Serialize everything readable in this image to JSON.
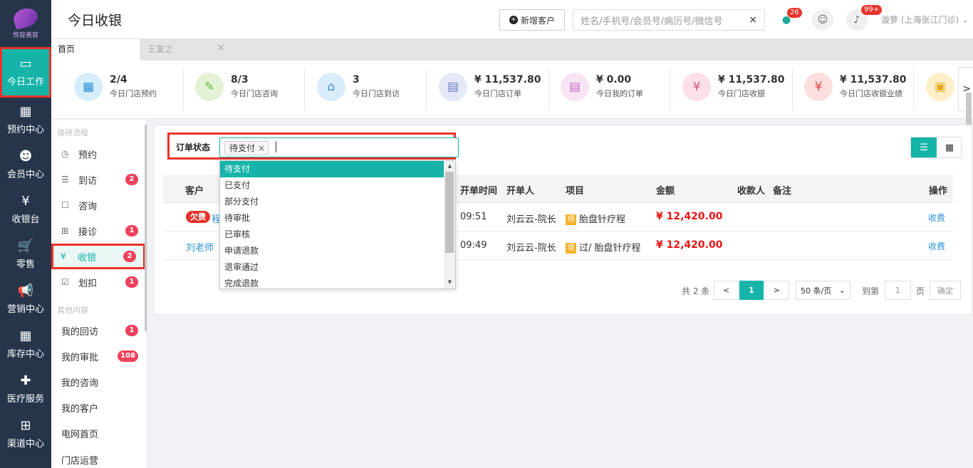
{
  "brand": {
    "logo_text": "悦容美容"
  },
  "leftnav": [
    {
      "label": "今日工作",
      "icon": "laptop-icon",
      "glyph": "▭"
    },
    {
      "label": "预约中心",
      "icon": "calendar-icon",
      "glyph": "▦"
    },
    {
      "label": "会员中心",
      "icon": "members-icon",
      "glyph": "☻"
    },
    {
      "label": "收银台",
      "icon": "yen-icon",
      "glyph": "¥"
    },
    {
      "label": "零售",
      "icon": "cart-icon",
      "glyph": "🛒"
    },
    {
      "label": "营销中心",
      "icon": "megaphone-icon",
      "glyph": "📢"
    },
    {
      "label": "库存中心",
      "icon": "grid-icon",
      "glyph": "▦"
    },
    {
      "label": "医疗服务",
      "icon": "medkit-icon",
      "glyph": "✚"
    },
    {
      "label": "渠道中心",
      "icon": "sitemap-icon",
      "glyph": "⊞"
    }
  ],
  "header": {
    "title": "今日收银",
    "new_customer": "新增客户",
    "search_placeholder": "姓名/手机号/会员号/病历号/微信号",
    "search_clear": "×",
    "wechat_badge": "26",
    "notify_badge": "99+",
    "user": "漩萝 (上海张江门诊)"
  },
  "tabs": {
    "home": "首页",
    "second": "王复之",
    "close": "×"
  },
  "stats": [
    {
      "value": "2/4",
      "label": "今日门店预约",
      "color": "#d6eef9",
      "fg": "#2a8fd6",
      "glyph": "▦"
    },
    {
      "value": "8/3",
      "label": "今日门店咨询",
      "color": "#e3f2d6",
      "fg": "#6bb34a",
      "glyph": "✎"
    },
    {
      "value": "3",
      "label": "今日门店到访",
      "color": "#d9ecfa",
      "fg": "#3d8fd6",
      "glyph": "⌂"
    },
    {
      "value": "¥ 11,537.80",
      "label": "今日门店订单",
      "color": "#e4e8f7",
      "fg": "#6d7fc9",
      "glyph": "▤"
    },
    {
      "value": "¥ 0.00",
      "label": "今日我的订单",
      "color": "#f7e4f5",
      "fg": "#c86bc2",
      "glyph": "▤"
    },
    {
      "value": "¥ 11,537.80",
      "label": "今日门店收银",
      "color": "#fbe0ea",
      "fg": "#e05586",
      "glyph": "¥"
    },
    {
      "value": "¥ 11,537.80",
      "label": "今日门店收银业绩",
      "color": "#fcdede",
      "fg": "#e0473f",
      "glyph": "¥"
    },
    {
      "value": "",
      "label": "",
      "color": "#fdefc8",
      "fg": "#e8a81a",
      "glyph": "▣"
    }
  ],
  "stats_next": ">",
  "sidebar": {
    "group1": "接待流程",
    "group2": "其他内容",
    "items": [
      {
        "label": "预约",
        "icon": "clock-icon",
        "glyph": "◷",
        "count": ""
      },
      {
        "label": "到访",
        "icon": "visit-icon",
        "glyph": "☰",
        "count": "2"
      },
      {
        "label": "咨询",
        "icon": "chat-icon",
        "glyph": "☐",
        "count": ""
      },
      {
        "label": "接诊",
        "icon": "plus-box-icon",
        "glyph": "⊞",
        "count": "1"
      },
      {
        "label": "收银",
        "icon": "yen-circle-icon",
        "glyph": "¥",
        "count": "2"
      },
      {
        "label": "划扣",
        "icon": "check-box-icon",
        "glyph": "☑",
        "count": "1"
      },
      {
        "label": "我的回访",
        "icon": "",
        "glyph": "",
        "count": "1"
      },
      {
        "label": "我的审批",
        "icon": "",
        "glyph": "",
        "count": "108"
      },
      {
        "label": "我的咨询",
        "icon": "",
        "glyph": "",
        "count": ""
      },
      {
        "label": "我的客户",
        "icon": "",
        "glyph": "",
        "count": ""
      },
      {
        "label": "电网首页",
        "icon": "",
        "glyph": "",
        "count": ""
      },
      {
        "label": "门店运营",
        "icon": "",
        "glyph": "",
        "count": ""
      }
    ]
  },
  "filter": {
    "label": "订单状态",
    "chip": "待支付",
    "chip_remove": "×"
  },
  "dropdown": {
    "options": [
      "待支付",
      "已支付",
      "部分支付",
      "待审批",
      "已审核",
      "申请退款",
      "退审通过",
      "完成退款"
    ],
    "up": "▲",
    "down": "▼"
  },
  "table": {
    "headers": {
      "customer": "客户",
      "time": "开单时间",
      "opener": "开单人",
      "item": "项目",
      "amount": "金额",
      "payee": "收款人",
      "note": "备注",
      "action": "操作"
    },
    "rows": [
      {
        "tag": "欠费",
        "customer": "程",
        "time": "09:51",
        "opener": "刘云云-院长",
        "item_tag": "项",
        "item": "胎盘针疗程",
        "amount": "¥ 12,420.00",
        "action": "收费"
      },
      {
        "tag": "",
        "customer": "刘老师",
        "time": "09:49",
        "opener": "刘云云-院长",
        "item_tag": "项",
        "item": "过/ 胎盘针疗程",
        "amount": "¥ 12,420.00",
        "action": "收费"
      }
    ]
  },
  "pager": {
    "total": "共 2 条",
    "prev": "<",
    "current": "1",
    "next": ">",
    "per_page": "50 条/页",
    "goto": "到第",
    "goto_value": "1",
    "page_unit": "页",
    "confirm": "确定"
  },
  "colors": {
    "accent": "#16b3a8",
    "nav": "#26354a",
    "danger": "#e8332a"
  }
}
